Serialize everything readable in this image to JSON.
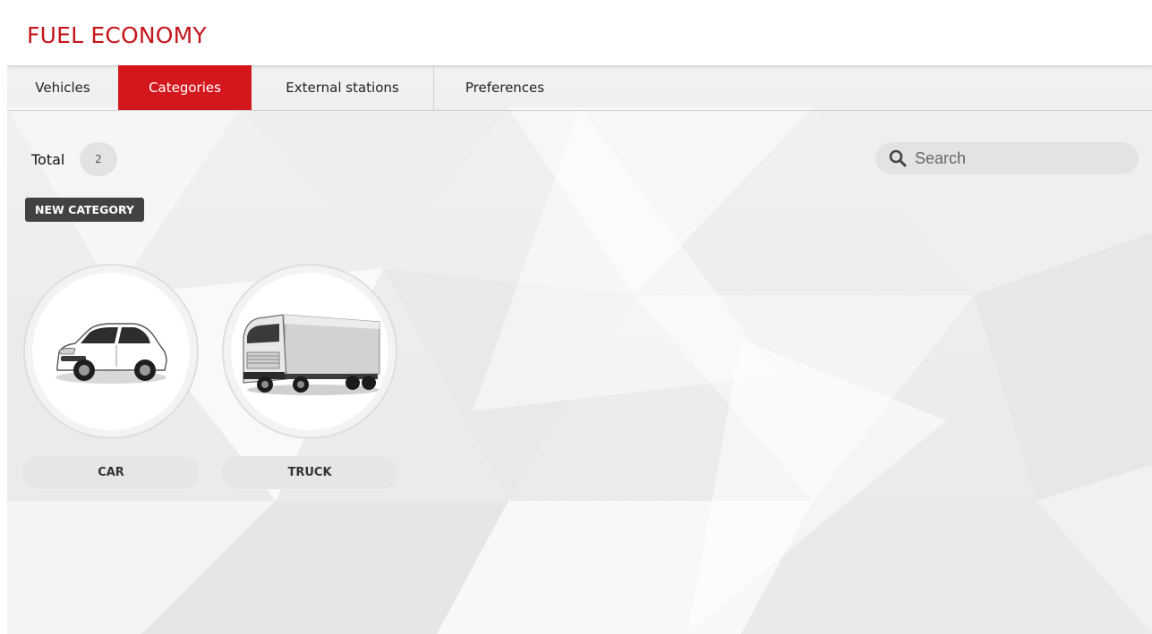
{
  "app": {
    "title": "FUEL ECONOMY"
  },
  "tabs": [
    {
      "label": "Vehicles",
      "active": false
    },
    {
      "label": "Categories",
      "active": true
    },
    {
      "label": "External stations",
      "active": false
    },
    {
      "label": "Preferences",
      "active": false
    }
  ],
  "summary": {
    "total_label": "Total",
    "total_count": "2"
  },
  "search": {
    "placeholder": "Search",
    "value": "",
    "icon": "search-icon"
  },
  "actions": {
    "new_category_label": "NEW CATEGORY"
  },
  "categories": [
    {
      "label": "CAR",
      "icon": "car-icon"
    },
    {
      "label": "TRUCK",
      "icon": "truck-icon"
    }
  ],
  "colors": {
    "brand_red": "#c4161c",
    "tab_active_bg": "#d4161d",
    "button_dark": "#424242"
  }
}
